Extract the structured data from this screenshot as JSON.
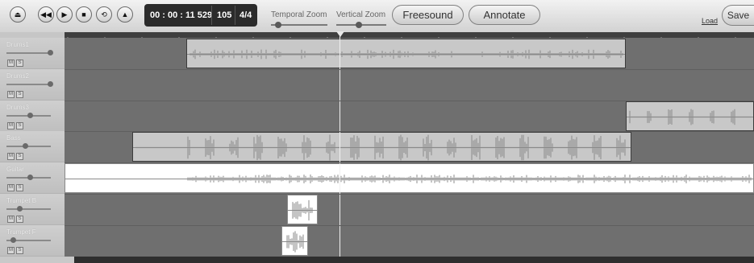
{
  "transport": {
    "eject_icon": "eject-icon",
    "rewind_icon": "rewind-icon",
    "play_icon": "play-icon",
    "stop_icon": "stop-icon",
    "loop_icon": "loop-icon",
    "metronome_icon": "metronome-icon"
  },
  "display": {
    "time": "00 : 00 : 11 529",
    "tempo": "105",
    "signature": "4/4"
  },
  "zoom": {
    "temporal_label": "Temporal Zoom",
    "vertical_label": "Vertical Zoom"
  },
  "buttons": {
    "freesound": "Freesound",
    "annotate": "Annotate",
    "load": "Load",
    "save": "Save"
  },
  "tracks": [
    {
      "name": "Drums1",
      "mute": "M",
      "solo": "S",
      "volume": 1.0
    },
    {
      "name": "Drums2",
      "mute": "M",
      "solo": "S",
      "volume": 1.0
    },
    {
      "name": "Drums3",
      "mute": "M",
      "solo": "S",
      "volume": 0.5
    },
    {
      "name": "Bass",
      "mute": "M",
      "solo": "S",
      "volume": 0.4
    },
    {
      "name": "Guitar",
      "mute": "M",
      "solo": "S",
      "volume": 0.5
    },
    {
      "name": "Trumpet B",
      "mute": "M",
      "solo": "S",
      "volume": 0.25
    },
    {
      "name": "Trumpet F",
      "mute": "M",
      "solo": "S",
      "volume": 0.1
    }
  ],
  "colors": {
    "lane_background": "#6f6f6f",
    "clip_gray": "#c8c8c8",
    "clip_white": "#ffffff",
    "waveform": "#8a8a8a",
    "display_background": "#2b2b2b"
  }
}
